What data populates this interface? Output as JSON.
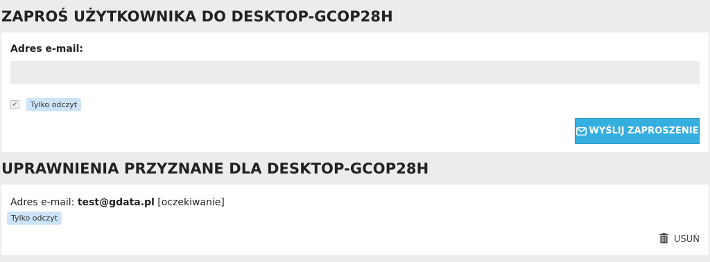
{
  "invite_section": {
    "title": "ZAPROŚ UŻYTKOWNIKA DO DESKTOP-GCOP28H",
    "email_label": "Adres e-mail:",
    "email_value": "",
    "readonly_checkbox": {
      "checked": true,
      "label": "Tylko odczyt"
    },
    "send_button": {
      "label": "WYŚLIJ ZAPROSZENIE",
      "icon": "envelope-icon"
    }
  },
  "permissions_section": {
    "title": "UPRAWNIENIA PRZYZNANE DLA DESKTOP-GCOP28H",
    "entries": [
      {
        "email_prefix": "Adres e-mail:",
        "email": "test@gdata.pl",
        "status": "[oczekiwanie]",
        "role_badge": "Tylko odczyt",
        "delete_label": "USUŃ",
        "delete_icon": "trash-icon"
      }
    ]
  },
  "colors": {
    "page_bg": "#ececec",
    "panel_bg": "#ffffff",
    "button_bg": "#35aee0",
    "badge_bg": "#cde3f7"
  }
}
